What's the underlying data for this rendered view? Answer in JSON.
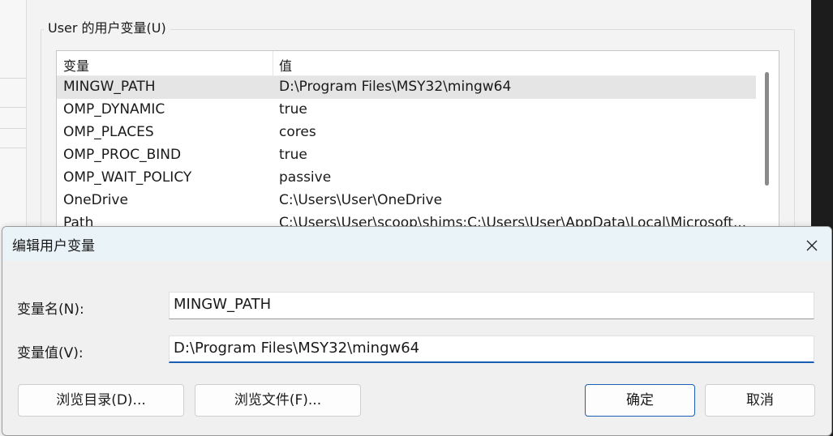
{
  "background_window": {
    "group_title": "User 的用户变量(U)",
    "columns": [
      "变量",
      "值"
    ],
    "rows": [
      {
        "name": "MINGW_PATH",
        "value": "D:\\Program Files\\MSY32\\mingw64",
        "selected": true
      },
      {
        "name": "OMP_DYNAMIC",
        "value": "true"
      },
      {
        "name": "OMP_PLACES",
        "value": "cores"
      },
      {
        "name": "OMP_PROC_BIND",
        "value": "true"
      },
      {
        "name": "OMP_WAIT_POLICY",
        "value": "passive"
      },
      {
        "name": "OneDrive",
        "value": "C:\\Users\\User\\OneDrive"
      },
      {
        "name": "Path",
        "value": "C:\\Users\\User\\scoop\\shims;C:\\Users\\User\\AppData\\Local\\Microsoft..."
      }
    ]
  },
  "dialog": {
    "title": "编辑用户变量",
    "name_label": "变量名(N):",
    "name_value": "MINGW_PATH",
    "value_label": "变量值(V):",
    "value_value": "D:\\Program Files\\MSY32\\mingw64",
    "buttons": {
      "browse_dir": "浏览目录(D)...",
      "browse_file": "浏览文件(F)...",
      "ok": "确定",
      "cancel": "取消"
    },
    "close_icon": "close-icon"
  },
  "colors": {
    "accent": "#1a5fb4",
    "titlebar": "#eaf3f8",
    "selected_row": "#e5e5e5"
  }
}
